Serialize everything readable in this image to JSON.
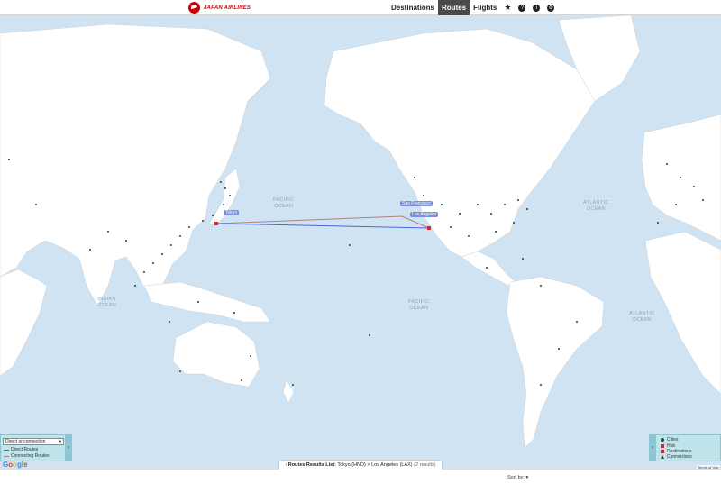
{
  "brand": {
    "logo_text": "JAPAN AIRLINES"
  },
  "nav": {
    "items": [
      {
        "label": "Destinations",
        "active": false
      },
      {
        "label": "Routes",
        "active": true
      },
      {
        "label": "Flights",
        "active": false
      }
    ],
    "icons": [
      "star-icon",
      "help-icon",
      "info-icon",
      "settings-icon"
    ]
  },
  "map": {
    "ocean_labels": [
      {
        "text": "PACIFIC\nOCEAN"
      },
      {
        "text": "PACIFIC\nOCEAN"
      },
      {
        "text": "INDIAN\nOCEAN"
      },
      {
        "text": "ATLANTIC\nOCEAN"
      },
      {
        "text": "ATLANTIC\nOCEAN"
      }
    ],
    "route_labels": [
      {
        "text": "Tokyo"
      },
      {
        "text": "San Francisco"
      },
      {
        "text": "Los Angeles"
      }
    ],
    "colors": {
      "ocean": "#cfe3f3",
      "land": "#ffffff",
      "direct_route": "#4a63d8",
      "connecting_route": "#b08080",
      "hub": "#e0202a"
    }
  },
  "connection_control": {
    "select_value": "Direct or connection",
    "legend": [
      {
        "label": "Direct Routes",
        "color": "#4a63d8"
      },
      {
        "label": "Connecting Routes",
        "color": "#b08080"
      }
    ]
  },
  "map_legend": {
    "items": [
      {
        "label": "Cities",
        "icon": "city-dot-icon",
        "color": "#1f4b2e"
      },
      {
        "label": "Hub",
        "icon": "hub-icon",
        "color": "#e0202a"
      },
      {
        "label": "Destinations",
        "icon": "destination-icon",
        "color": "#e0202a"
      },
      {
        "label": "Connections",
        "icon": "connection-icon",
        "color": "#1f4b2e"
      }
    ]
  },
  "results": {
    "title": "Routes Results List:",
    "query": "Tokyo (HND) > Los Angeles (LAX)",
    "count": "(2 results)"
  },
  "sort": {
    "label": "Sort by:"
  },
  "footer": {
    "google": "Google",
    "terms": "Terms of Use"
  }
}
